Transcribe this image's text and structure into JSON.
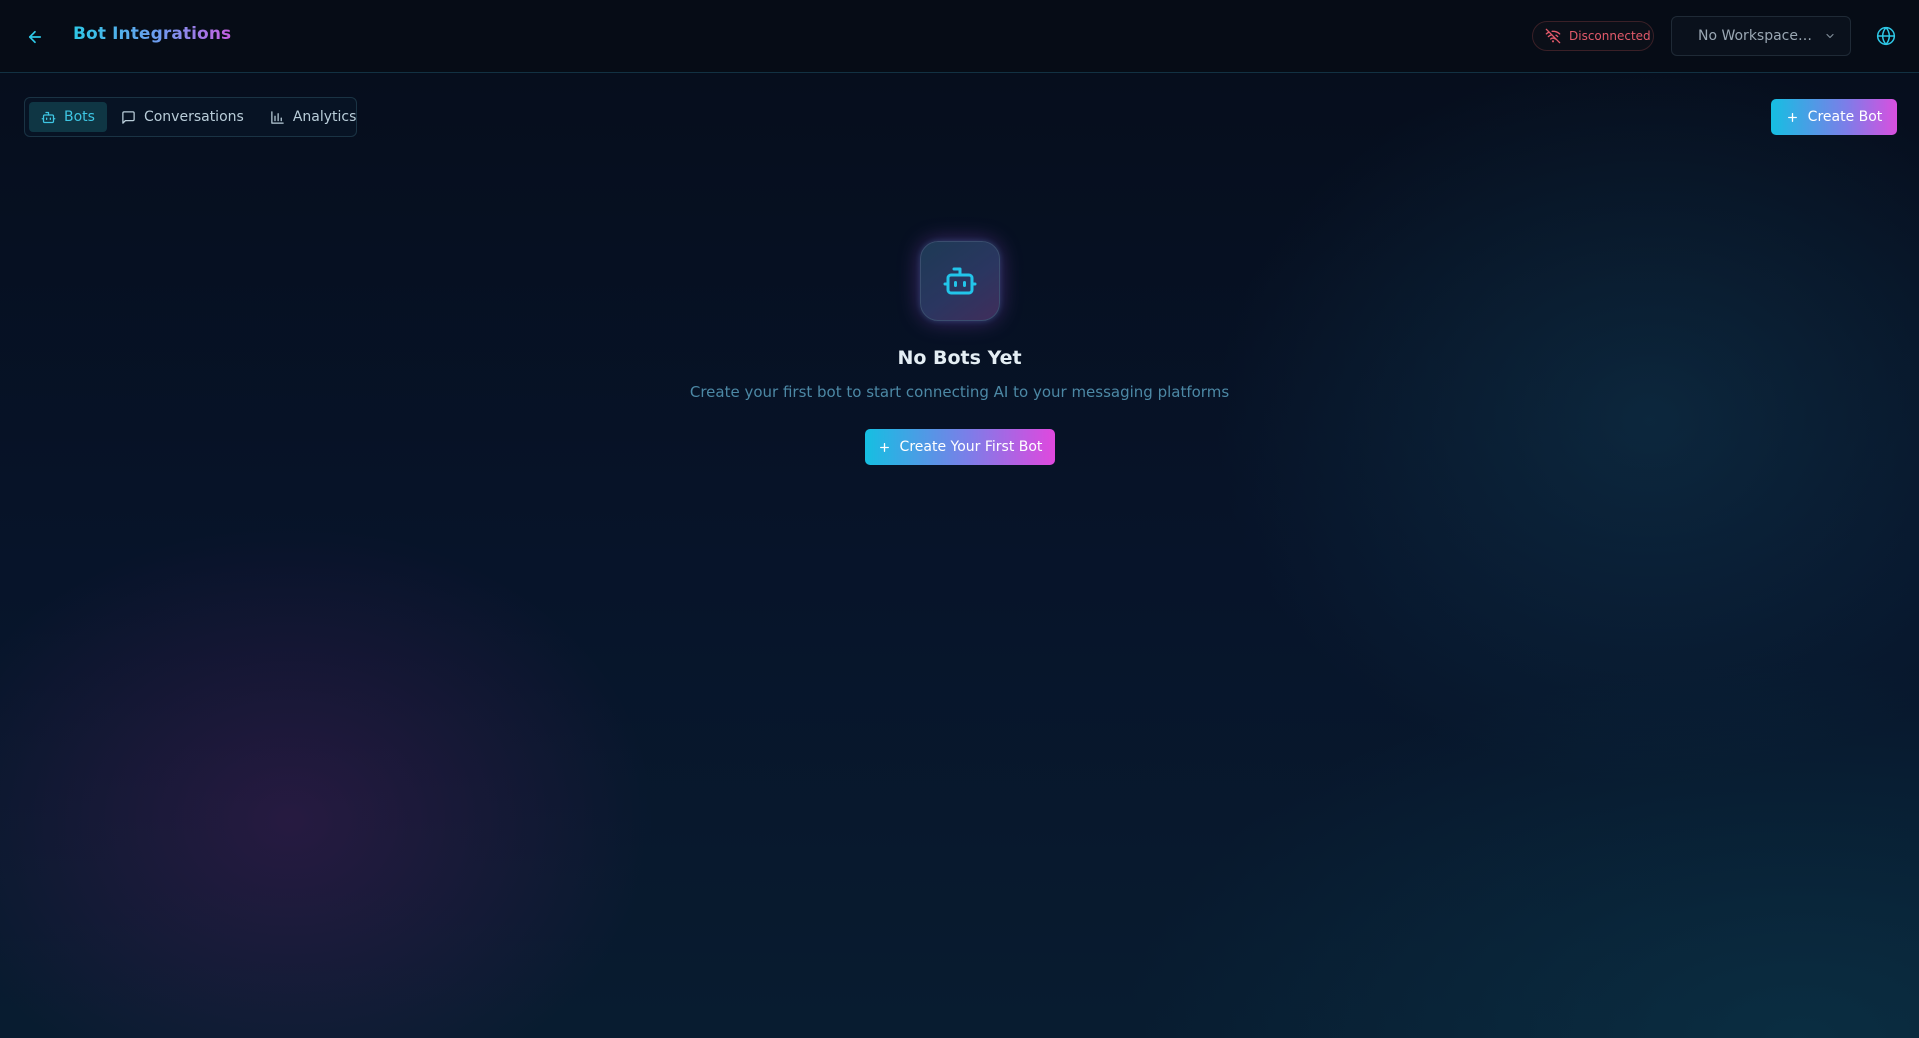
{
  "header": {
    "title": "Bot Integrations",
    "status": "Disconnected",
    "workspace": "No Workspace…",
    "icons": {
      "back": "arrow-left-icon",
      "status": "wifi-off-icon",
      "workspace": "chevron-down-icon",
      "language": "globe-icon"
    }
  },
  "tabs": [
    {
      "label": "Bots",
      "icon": "bot-icon",
      "active": true
    },
    {
      "label": "Conversations",
      "icon": "message-square-icon",
      "active": false
    },
    {
      "label": "Analytics",
      "icon": "bar-chart-icon",
      "active": false
    }
  ],
  "actions": {
    "create_bot": "Create Bot"
  },
  "empty_state": {
    "icon": "bot-icon",
    "title": "No Bots Yet",
    "description": "Create your first bot to start connecting AI to your messaging platforms",
    "button": "Create Your First Bot"
  },
  "colors": {
    "accent_cyan": "#15bfe2",
    "accent_magenta": "#d94fdf",
    "status_error": "#e25a6a",
    "background": "#060d1b"
  }
}
